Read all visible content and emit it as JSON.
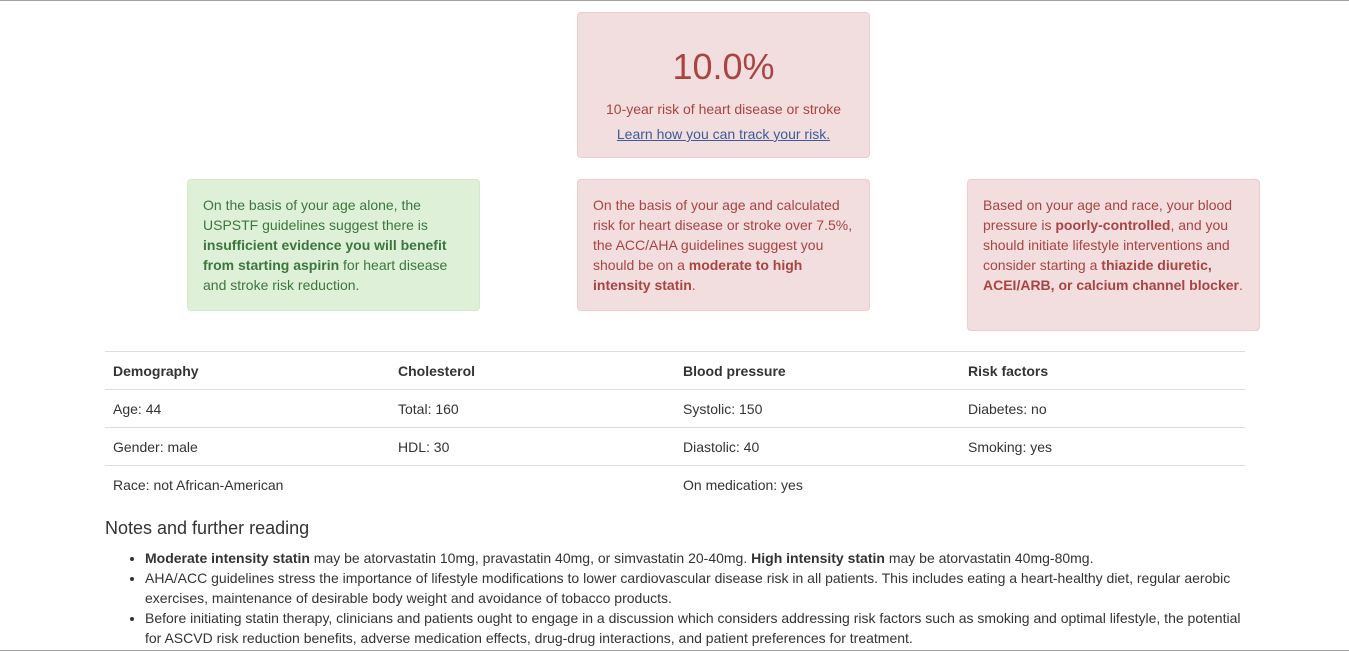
{
  "risk": {
    "value": "10.0%",
    "description": "10-year risk of heart disease or stroke",
    "link": "Learn how you can track your risk."
  },
  "recommendations": {
    "aspirin": {
      "pre": "On the basis of your age alone, the USPSTF guidelines suggest there is ",
      "bold": "insufficient evidence you will benefit from starting aspirin",
      "post": " for heart disease and stroke risk reduction."
    },
    "statin": {
      "pre": "On the basis of your age and calculated risk for heart disease or stroke over 7.5%, the ACC/AHA guidelines suggest you should be on a ",
      "bold": "moderate to high intensity statin",
      "post": "."
    },
    "bp": {
      "pre": "Based on your age and race, your blood pressure is ",
      "bold1": "poorly-controlled",
      "mid": ", and you should initiate lifestyle interventions and consider starting a ",
      "bold2": "thiazide diuretic, ACEI/ARB, or calcium channel blocker",
      "post": "."
    }
  },
  "table": {
    "headers": [
      "Demography",
      "Cholesterol",
      "Blood pressure",
      "Risk factors"
    ],
    "rows": [
      [
        "Age: 44",
        "Total: 160",
        "Systolic: 150",
        "Diabetes: no"
      ],
      [
        "Gender: male",
        "HDL: 30",
        "Diastolic: 40",
        "Smoking: yes"
      ],
      [
        "Race: not African-American",
        "",
        "On medication: yes",
        ""
      ]
    ]
  },
  "notes": {
    "title": "Notes and further reading",
    "items": [
      {
        "bold1": "Moderate intensity statin",
        "text1": " may be atorvastatin 10mg, pravastatin 40mg, or simvastatin 20-40mg. ",
        "bold2": "High intensity statin",
        "text2": " may be atorvastatin 40mg-80mg."
      },
      {
        "text": "AHA/ACC guidelines stress the importance of lifestyle modifications to lower cardiovascular disease risk in all patients. This includes eating a heart-healthy diet, regular aerobic exercises, maintenance of desirable body weight and avoidance of tobacco products."
      },
      {
        "text": "Before initiating statin therapy, clinicians and patients ought to engage in a discussion which considers addressing risk factors such as smoking and optimal lifestyle, the potential for ASCVD risk reduction benefits, adverse medication effects, drug-drug interactions, and patient preferences for treatment."
      }
    ]
  }
}
